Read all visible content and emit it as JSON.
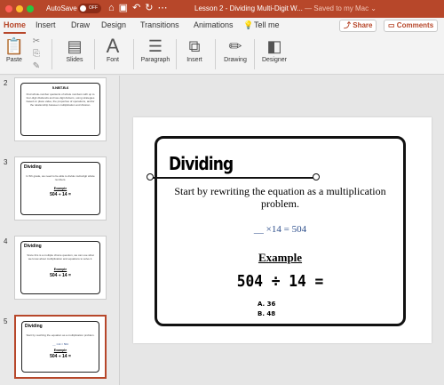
{
  "titlebar": {
    "autosave_label": "AutoSave",
    "autosave_state": "OFF",
    "doc_title": "Lesson 2 - Dividing Multi-Digit W...",
    "saved_status": "— Saved to my Mac ⌄",
    "colors": {
      "brand": "#b7472a"
    }
  },
  "ribbon_tabs": [
    "Home",
    "Insert",
    "Draw",
    "Design",
    "Transitions",
    "Animations",
    "Tell me"
  ],
  "ribbon_buttons": {
    "share": "Share",
    "comments": "Comments"
  },
  "ribbon_groups": {
    "paste": "Paste",
    "slides": "Slides",
    "font": "Font",
    "paragraph": "Paragraph",
    "insert": "Insert",
    "drawing": "Drawing",
    "designer": "Designer"
  },
  "thumbnails": [
    {
      "number": "2",
      "title": "5.NBT.B.6",
      "text": "Find whole-number quotients of whole numbers with up to four-digit dividends and two-digit divisors, using strategies based on place value, the properties of operations, and/or the relationship between multiplication and division."
    },
    {
      "number": "3",
      "title": "Dividing",
      "text": "In 5th grade, we need to be able to divide multi-digit whole numbers.",
      "example": "Example",
      "math": "504 ÷ 14 ="
    },
    {
      "number": "4",
      "title": "Dividing",
      "text": "Since this is a multiple choice question, we can use what we know about multiplication and equations to solve it.",
      "example": "Example",
      "math": "504 ÷ 14 ="
    },
    {
      "number": "5",
      "title": "Dividing",
      "text": "Start by rewriting the equation as a multiplication problem.",
      "eq": "__ ×14 = 504",
      "example": "Example",
      "math": "504 ÷ 14 ="
    }
  ],
  "slide": {
    "title": "Dividing",
    "body": "Start by rewriting the equation as a multiplication problem.",
    "equation": "__ ×14 = 504",
    "example_label": "Example",
    "math": "504 ÷ 14 =",
    "options": [
      "A. 36",
      "B. 48"
    ]
  }
}
